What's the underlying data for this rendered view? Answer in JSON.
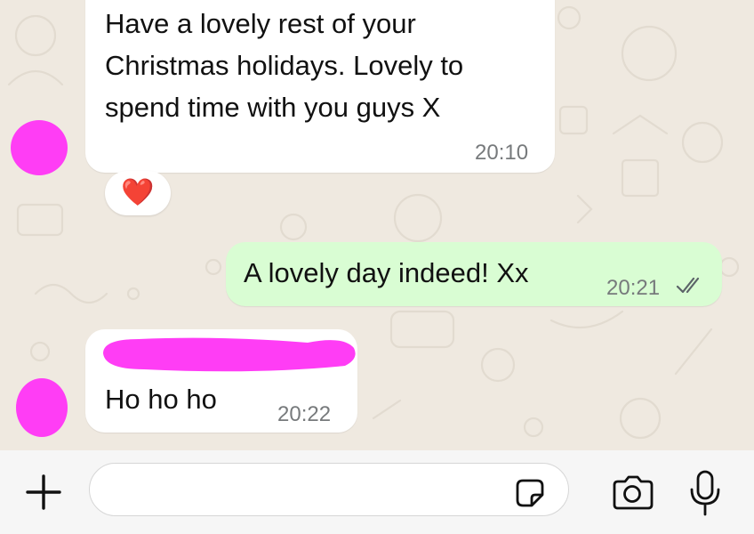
{
  "messages": [
    {
      "id": "m1",
      "direction": "incoming",
      "text_lines": [
        "Have a lovely rest of your",
        "Christmas holidays. Lovely to",
        "spend time with you guys X"
      ],
      "time": "20:10",
      "reaction": "❤️"
    },
    {
      "id": "m2",
      "direction": "outgoing",
      "text": "A lovely day indeed! Xx",
      "time": "20:21",
      "status": "read",
      "status_color": "#5b6368"
    },
    {
      "id": "m3",
      "direction": "incoming",
      "sender_name_redacted": true,
      "text": "Ho ho ho",
      "time": "20:22"
    }
  ],
  "composer": {
    "input_value": "",
    "placeholder": ""
  },
  "icons": {
    "attach": "plus-icon",
    "sticker": "sticker-icon",
    "camera": "camera-icon",
    "mic": "microphone-icon"
  },
  "colors": {
    "incoming_bubble": "#ffffff",
    "outgoing_bubble": "#d9fdd3",
    "chat_background": "#efe9e0",
    "redaction": "#ff3df5"
  }
}
